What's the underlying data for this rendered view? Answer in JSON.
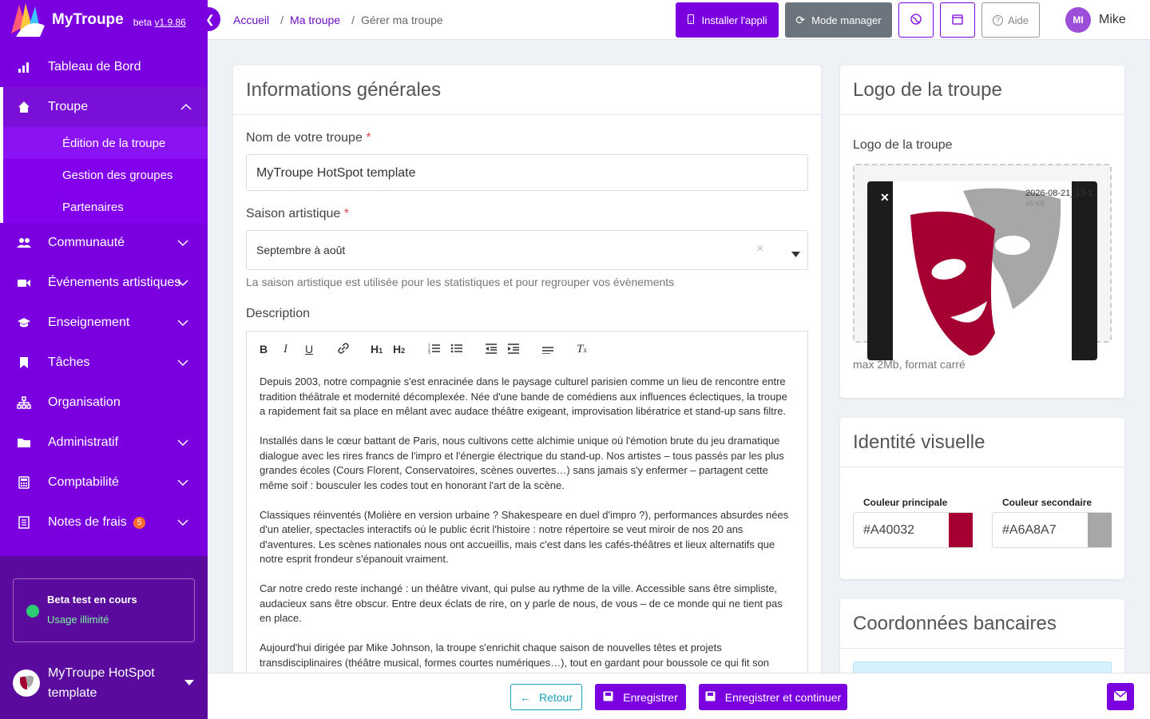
{
  "brand": {
    "name": "MyTroupe",
    "beta_label": "beta",
    "version": "v1.9.86"
  },
  "topbar": {
    "breadcrumb": [
      {
        "label": "Accueil"
      },
      {
        "label": "Ma troupe"
      },
      {
        "label": "Gérer ma troupe"
      }
    ],
    "install_label": "Installer l'appli",
    "manager_label": "Mode manager",
    "help_label": "Aide",
    "user": {
      "initials": "MI",
      "name": "Mike"
    }
  },
  "sidebar": {
    "items": [
      {
        "label": "Tableau de Bord",
        "icon": "bar-chart-icon"
      },
      {
        "label": "Troupe",
        "icon": "home-icon",
        "expanded": true
      },
      {
        "label": "Communauté",
        "icon": "users-icon"
      },
      {
        "label": "Événements artistiques",
        "icon": "video-icon"
      },
      {
        "label": "Enseignement",
        "icon": "graduation-cap-icon"
      },
      {
        "label": "Tâches",
        "icon": "bookmark-icon"
      },
      {
        "label": "Organisation",
        "icon": "org-chart-icon"
      },
      {
        "label": "Administratif",
        "icon": "folder-icon"
      },
      {
        "label": "Comptabilité",
        "icon": "calculator-icon"
      },
      {
        "label": "Notes de frais",
        "icon": "receipt-icon",
        "badge": "5"
      }
    ],
    "subitems": [
      {
        "label": "Édition de la troupe"
      },
      {
        "label": "Gestion des groupes"
      },
      {
        "label": "Partenaires"
      }
    ],
    "beta": {
      "title": "Beta test en cours",
      "status": "Usage illimité"
    },
    "troupe_selector": "MyTroupe HotSpot template"
  },
  "general": {
    "title": "Informations générales",
    "name_label": "Nom de votre troupe",
    "required_mark": "*",
    "name_value": "MyTroupe HotSpot template",
    "season_label": "Saison artistique",
    "season_value": "Septembre à août",
    "season_help": "La saison artistique est utilisée pour les statistiques et pour regrouper vos évènements",
    "description_label": "Description",
    "toolbar": [
      "B",
      "I",
      "U",
      "link",
      "H1",
      "H2",
      "ordered-list",
      "bullet-list",
      "outdent",
      "indent",
      "align",
      "clear-format"
    ],
    "description": [
      "Depuis 2003, notre compagnie s'est enracinée dans le paysage culturel parisien comme un lieu de rencontre entre tradition théâtrale et modernité décomplexée. Née d'une bande de comédiens aux influences éclectiques, la troupe a rapidement fait sa place en mêlant avec audace théâtre exigeant, improvisation libératrice et stand-up sans filtre.",
      "Installés dans le cœur battant de Paris, nous cultivons cette alchimie unique où l'émotion brute du jeu dramatique dialogue avec les rires francs de l'impro et l'énergie électrique du stand-up. Nos artistes – tous passés par les plus grandes écoles (Cours Florent, Conservatoires, scènes ouvertes…) sans jamais s'y enfermer – partagent cette même soif : bousculer les codes tout en honorant l'art de la scène.",
      "Classiques réinventés (Molière en version urbaine ? Shakespeare en duel d'impro ?), performances absurdes nées d'un atelier, spectacles interactifs où le public écrit l'histoire : notre répertoire se veut miroir de nos 20 ans d'aventures. Les scènes nationales nous ont accueillis, mais c'est dans les cafés-théâtres et lieux alternatifs que notre esprit frondeur s'épanouit vraiment.",
      "Car notre credo reste inchangé : un théâtre vivant, qui pulse au rythme de la ville. Accessible sans être simpliste, audacieux sans être obscur. Entre deux éclats de rire, on y parle de nous, de vous – de ce monde qui ne tient pas en place.",
      "Aujourd'hui dirigée par Mike Johnson, la troupe s'enrichit chaque saison de nouvelles têtes et projets transdisciplinaires (théâtre musical, formes courtes numériques…), tout en gardant pour boussole ce qui fit son"
    ]
  },
  "logo": {
    "title": "Logo de la troupe",
    "field_label": "Logo de la troupe",
    "file_name": "2026-08-21_13-1",
    "file_size": "45 KB",
    "hint": "max 2Mb, format carré"
  },
  "identity": {
    "title": "Identité visuelle",
    "primary_label": "Couleur principale",
    "primary_value": "#A40032",
    "secondary_label": "Couleur secondaire",
    "secondary_value": "#A6A8A7"
  },
  "bank": {
    "title": "Coordonnées bancaires"
  },
  "footer": {
    "back_label": "Retour",
    "save_label": "Enregistrer",
    "save_continue_label": "Enregistrer et continuer"
  },
  "colors": {
    "accent": "#7b00e0",
    "dark_accent": "#5a0b9e",
    "primary_brand": "#A40032",
    "secondary_brand": "#A6A8A7"
  }
}
